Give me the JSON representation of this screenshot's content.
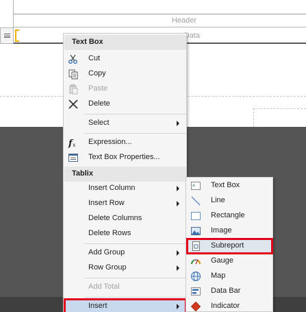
{
  "design_surface": {
    "header_label": "Header",
    "data_label": "Data"
  },
  "context_menu": {
    "sections": [
      {
        "header": "Text Box",
        "items": [
          {
            "label": "Cut",
            "icon": "scissors-icon",
            "enabled": true
          },
          {
            "label": "Copy",
            "icon": "copy-icon",
            "enabled": true
          },
          {
            "label": "Paste",
            "icon": "paste-icon",
            "enabled": false
          },
          {
            "label": "Delete",
            "icon": "delete-x-icon",
            "enabled": true
          },
          {
            "label": "Select",
            "has_submenu": true,
            "enabled": true
          },
          {
            "label": "Expression...",
            "icon": "fx-icon",
            "enabled": true
          },
          {
            "label": "Text Box Properties...",
            "icon": "properties-icon",
            "enabled": true
          }
        ]
      },
      {
        "header": "Tablix",
        "items": [
          {
            "label": "Insert Column",
            "has_submenu": true,
            "enabled": true
          },
          {
            "label": "Insert Row",
            "has_submenu": true,
            "enabled": true
          },
          {
            "label": "Delete Columns",
            "enabled": true
          },
          {
            "label": "Delete Rows",
            "enabled": true
          },
          {
            "label": "Add Group",
            "has_submenu": true,
            "enabled": true
          },
          {
            "label": "Row Group",
            "has_submenu": true,
            "enabled": true
          },
          {
            "label": "Add Total",
            "enabled": false
          },
          {
            "label": "Insert",
            "has_submenu": true,
            "enabled": true,
            "highlighted": true
          }
        ]
      }
    ]
  },
  "insert_submenu": {
    "items": [
      {
        "label": "Text Box",
        "icon": "textbox-icon"
      },
      {
        "label": "Line",
        "icon": "line-icon"
      },
      {
        "label": "Rectangle",
        "icon": "rectangle-icon"
      },
      {
        "label": "Image",
        "icon": "image-icon"
      },
      {
        "label": "Subreport",
        "icon": "subreport-icon",
        "highlighted": true
      },
      {
        "label": "Gauge",
        "icon": "gauge-icon"
      },
      {
        "label": "Map",
        "icon": "map-globe-icon"
      },
      {
        "label": "Data Bar",
        "icon": "databar-icon"
      },
      {
        "label": "Indicator",
        "icon": "indicator-icon"
      }
    ]
  },
  "colors": {
    "highlight_outline": "#e2001a",
    "selection_handle": "#f0b000",
    "dark_surface": "#555555",
    "menu_background": "#f5f5f5",
    "menu_header": "#e6e6e6"
  }
}
